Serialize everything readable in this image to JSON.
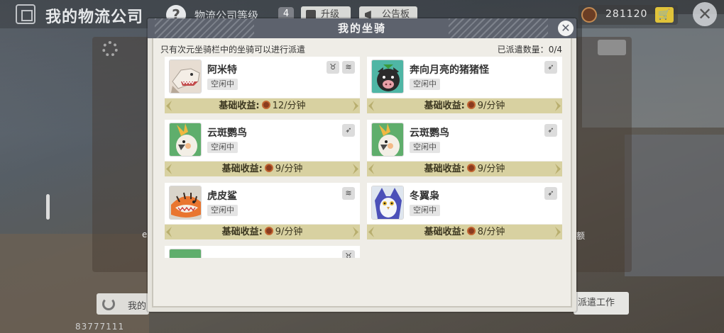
{
  "topbar": {
    "title": "我的物流公司",
    "help": "?",
    "level_label": "物流公司等级",
    "level": "4",
    "upgrade": "升级",
    "board": "公告板",
    "coins": "281120",
    "cart": "🛒",
    "close": "✕"
  },
  "background": {
    "left_note": "e",
    "right_note": "额",
    "bottom_left": "我的",
    "bottom_right": "派遣工作",
    "uid": "83777111"
  },
  "modal": {
    "title": "我的坐骑",
    "close": "✕",
    "hint": "只有次元坐骑栏中的坐骑可以进行派遣",
    "dispatch_label": "已派遣数量：",
    "dispatch_count": "0/4",
    "income_label": "基础收益:",
    "mounts": [
      {
        "name": "阿米特",
        "status": "空闲中",
        "income": "12/分钟",
        "types": [
          "horn",
          "swim"
        ]
      },
      {
        "name": "奔向月亮的猪猪怪",
        "status": "空闲中",
        "income": "9/分钟",
        "types": [
          "fly"
        ]
      },
      {
        "name": "云斑鹦鸟",
        "status": "空闲中",
        "income": "9/分钟",
        "types": [
          "fly"
        ]
      },
      {
        "name": "云斑鹦鸟",
        "status": "空闲中",
        "income": "9/分钟",
        "types": [
          "fly"
        ]
      },
      {
        "name": "虎皮鲨",
        "status": "空闲中",
        "income": "9/分钟",
        "types": [
          "swim"
        ]
      },
      {
        "name": "冬翼枭",
        "status": "空闲中",
        "income": "8/分钟",
        "types": [
          "fly"
        ]
      },
      {
        "name": "",
        "status": "",
        "income": "",
        "types": [
          "horn"
        ]
      }
    ]
  }
}
